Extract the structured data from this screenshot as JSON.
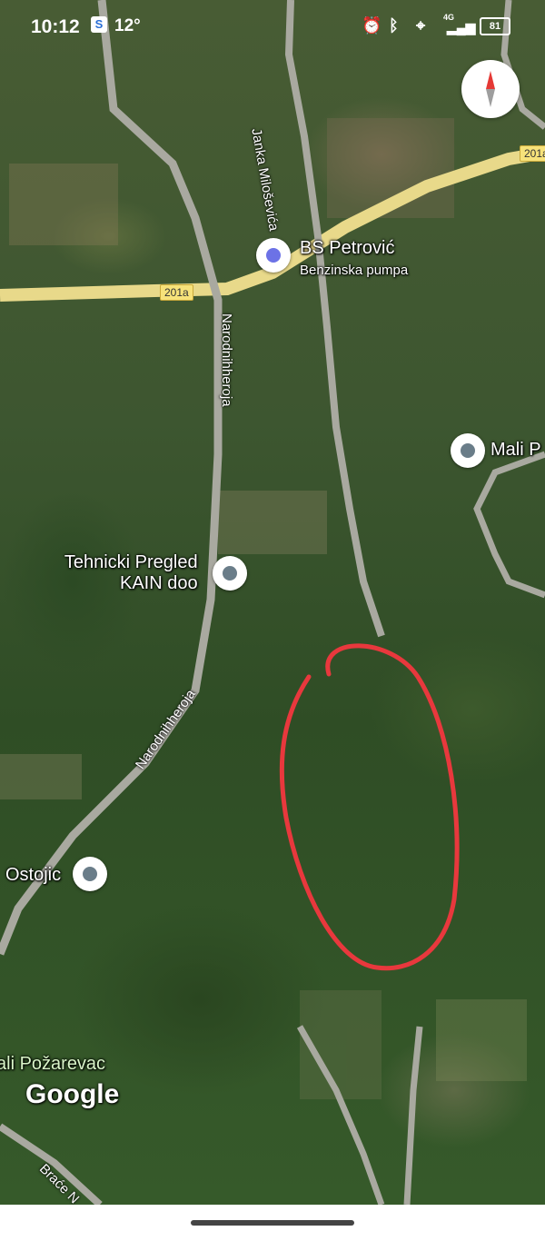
{
  "status_bar": {
    "time": "10:12",
    "temperature": "12°",
    "network": "4G",
    "battery": "81"
  },
  "roads": {
    "regional_route": "201a",
    "regional_route_east": "201a",
    "janka_milosevica": "Janka Miloševića",
    "narodnih_heroja_north": "Narodnihheroja",
    "narodnih_heroja_south": "Narodnihheroja",
    "brace_partial": "Braće N"
  },
  "places": {
    "fuel_station_name": "BS Petrović",
    "fuel_station_type": "Benzinska pumpa",
    "inspection_line1": "Tehnicki Pregled",
    "inspection_line2": "KAIN doo",
    "mali_partial": "Mali P",
    "ostojic": "Ostojic",
    "village_partial": "ali Požarevac"
  },
  "branding": {
    "logo": "Google"
  },
  "icons": {
    "compass": "compass-icon",
    "fuel": "gas-pump-icon",
    "pin": "place-pin-icon"
  },
  "colors": {
    "annotation": "#e8383d",
    "road": "#e8d98a",
    "minor_road": "#a9a9a0"
  }
}
